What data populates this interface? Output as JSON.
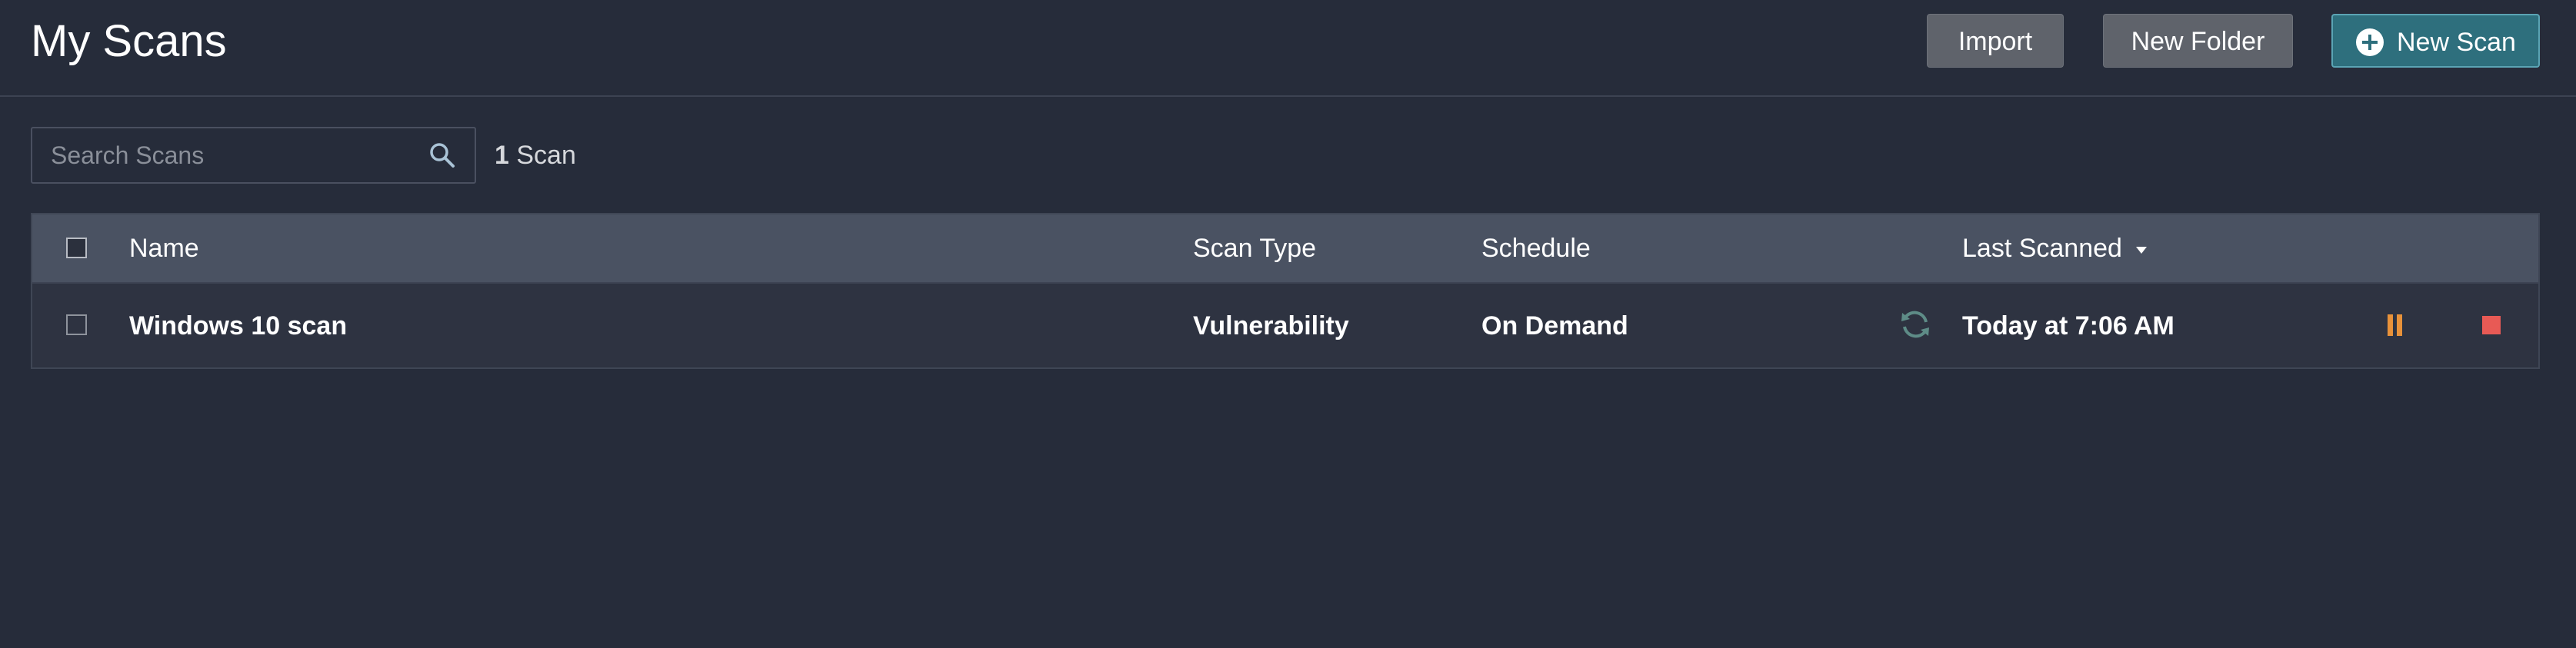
{
  "header": {
    "title": "My Scans",
    "import_label": "Import",
    "new_folder_label": "New Folder",
    "new_scan_label": "New Scan"
  },
  "search": {
    "placeholder": "Search Scans",
    "value": ""
  },
  "scan_count": {
    "number": "1",
    "label": "Scan"
  },
  "table": {
    "columns": {
      "name": "Name",
      "scan_type": "Scan Type",
      "schedule": "Schedule",
      "last_scanned": "Last Scanned"
    },
    "rows": [
      {
        "name": "Windows 10 scan",
        "scan_type": "Vulnerability",
        "schedule": "On Demand",
        "status_icon": "refresh-icon",
        "last_scanned": "Today at 7:06 AM"
      }
    ]
  },
  "colors": {
    "background": "#262c3a",
    "header_row": "#4a5262",
    "accent": "#2e6f7d",
    "pause": "#e8923a",
    "stop": "#e85a55"
  }
}
